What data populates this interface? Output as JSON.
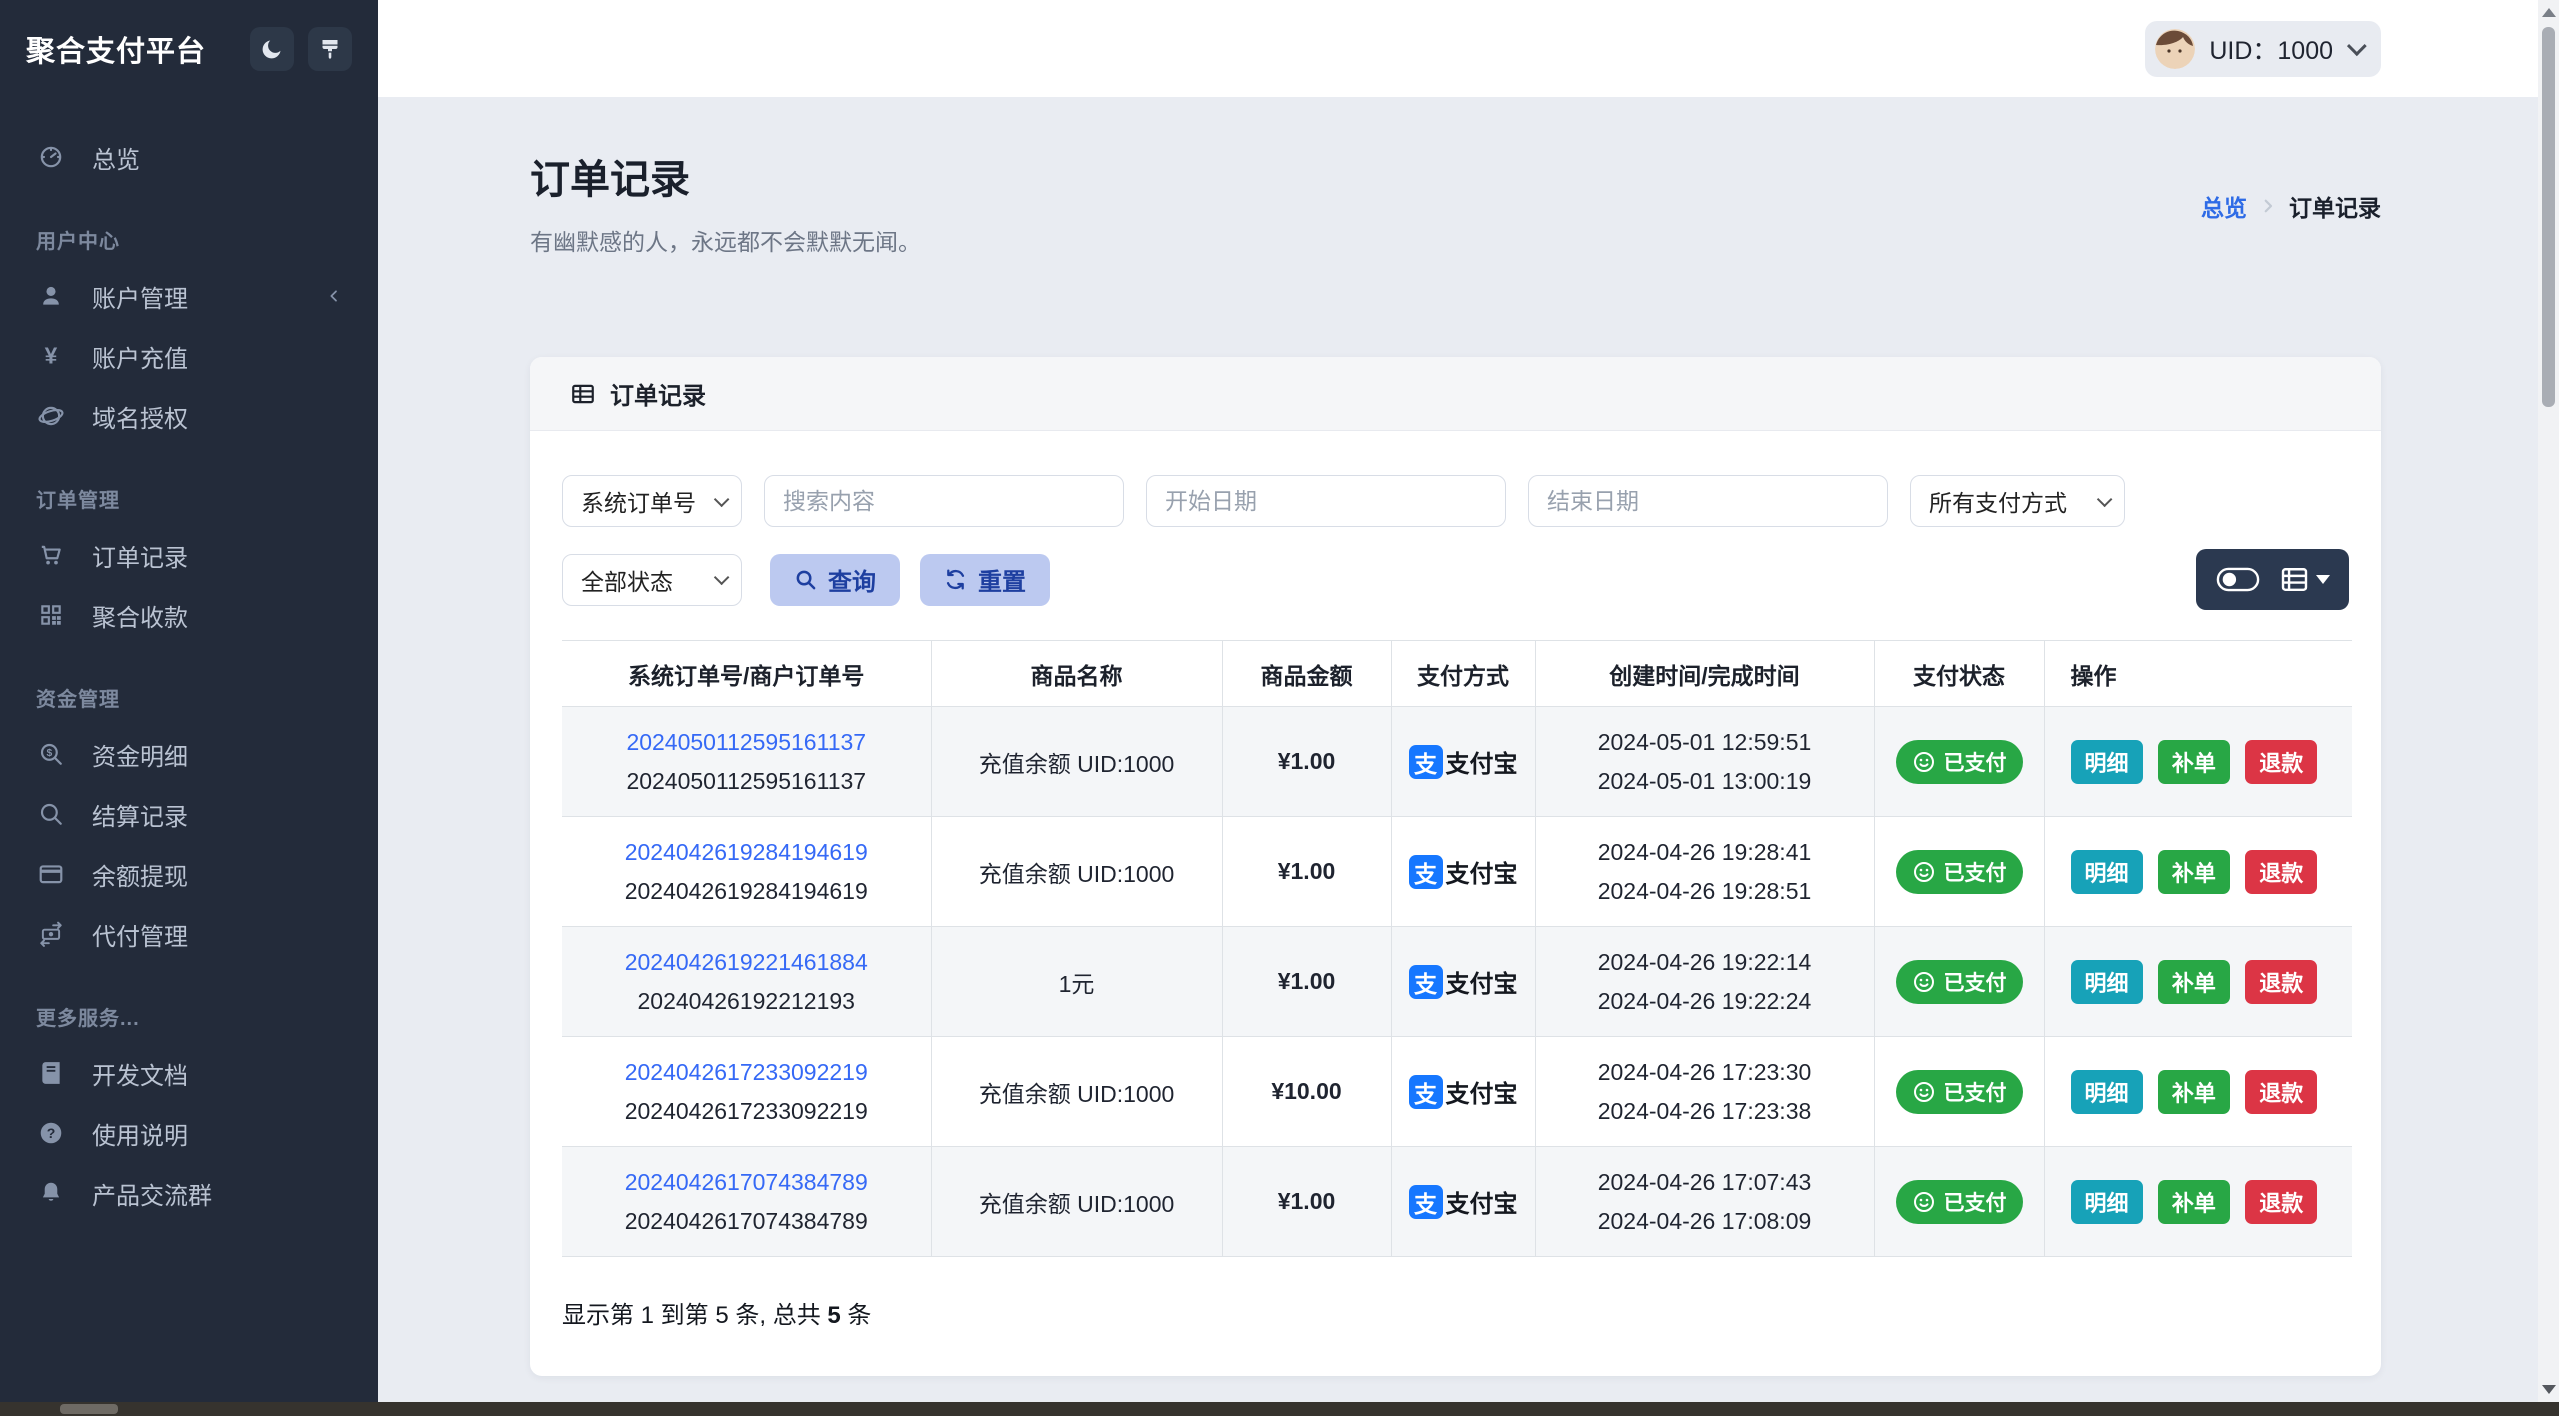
{
  "app": {
    "title": "聚合支付平台"
  },
  "topbar": {
    "uid": "UID：1000"
  },
  "sidebar": {
    "sections": [
      {
        "key": "main",
        "label": "",
        "items": [
          {
            "key": "overview",
            "label": "总览",
            "icon": "dashboard-icon"
          }
        ]
      },
      {
        "key": "user-center",
        "label": "用户中心",
        "items": [
          {
            "key": "account-management",
            "label": "账户管理",
            "icon": "user-icon",
            "collapsible": true
          },
          {
            "key": "account-recharge",
            "label": "账户充值",
            "icon": "yen-icon"
          },
          {
            "key": "domain-authorization",
            "label": "域名授权",
            "icon": "globe-icon"
          }
        ]
      },
      {
        "key": "order-management",
        "label": "订单管理",
        "items": [
          {
            "key": "order-records",
            "label": "订单记录",
            "icon": "cart-icon"
          },
          {
            "key": "aggregate-collection",
            "label": "聚合收款",
            "icon": "qrcode-icon"
          }
        ]
      },
      {
        "key": "fund-management",
        "label": "资金管理",
        "items": [
          {
            "key": "fund-details",
            "label": "资金明细",
            "icon": "search-dollar-icon"
          },
          {
            "key": "settlement-records",
            "label": "结算记录",
            "icon": "search-icon"
          },
          {
            "key": "balance-withdrawal",
            "label": "余额提现",
            "icon": "credit-card-icon"
          },
          {
            "key": "payout-management",
            "label": "代付管理",
            "icon": "money-transfer-icon"
          }
        ]
      },
      {
        "key": "more-services",
        "label": "更多服务...",
        "items": [
          {
            "key": "dev-docs",
            "label": "开发文档",
            "icon": "book-icon"
          },
          {
            "key": "usage-guide",
            "label": "使用说明",
            "icon": "question-icon"
          },
          {
            "key": "product-group",
            "label": "产品交流群",
            "icon": "bell-icon"
          }
        ]
      }
    ]
  },
  "page": {
    "title": "订单记录",
    "subtitle": "有幽默感的人，永远都不会默默无闻。",
    "breadcrumb": {
      "parent": "总览",
      "current": "订单记录"
    }
  },
  "card": {
    "header": "订单记录"
  },
  "filters": {
    "order_type_value": "系统订单号",
    "search_placeholder": "搜索内容",
    "start_date_placeholder": "开始日期",
    "end_date_placeholder": "结束日期",
    "pay_method_value": "所有支付方式",
    "status_value": "全部状态",
    "query_label": "查询",
    "reset_label": "重置"
  },
  "table": {
    "columns": [
      "系统订单号/商户订单号",
      "商品名称",
      "商品金额",
      "支付方式",
      "创建时间/完成时间",
      "支付状态",
      "操作"
    ],
    "action_labels": [
      "明细",
      "补单",
      "退款"
    ],
    "rows": [
      {
        "order_no": "2024050112595161137",
        "merchant_no": "2024050112595161137",
        "product": "充值余额 UID:1000",
        "amount": "¥1.00",
        "method": "支付宝",
        "created": "2024-05-01 12:59:51",
        "completed": "2024-05-01 13:00:19",
        "status": "已支付"
      },
      {
        "order_no": "2024042619284194619",
        "merchant_no": "2024042619284194619",
        "product": "充值余额 UID:1000",
        "amount": "¥1.00",
        "method": "支付宝",
        "created": "2024-04-26 19:28:41",
        "completed": "2024-04-26 19:28:51",
        "status": "已支付"
      },
      {
        "order_no": "2024042619221461884",
        "merchant_no": "20240426192212193",
        "product": "1元",
        "amount": "¥1.00",
        "method": "支付宝",
        "created": "2024-04-26 19:22:14",
        "completed": "2024-04-26 19:22:24",
        "status": "已支付"
      },
      {
        "order_no": "2024042617233092219",
        "merchant_no": "2024042617233092219",
        "product": "充值余额 UID:1000",
        "amount": "¥10.00",
        "method": "支付宝",
        "created": "2024-04-26 17:23:30",
        "completed": "2024-04-26 17:23:38",
        "status": "已支付"
      },
      {
        "order_no": "2024042617074384789",
        "merchant_no": "2024042617074384789",
        "product": "充值余额 UID:1000",
        "amount": "¥1.00",
        "method": "支付宝",
        "created": "2024-04-26 17:07:43",
        "completed": "2024-04-26 17:08:09",
        "status": "已支付"
      }
    ],
    "alipay_glyph": "支"
  },
  "summary": {
    "prefix": "显示第 1 到第 5 条, 总共 ",
    "total": "5",
    "suffix": " 条"
  },
  "colors": {
    "sidebar_bg": "#232b3a",
    "accent_blue": "#2e6be6",
    "link_blue": "#3569f6",
    "alipay_blue": "#1677ff",
    "paid_green": "#28a745",
    "detail_teal": "#17a2b8",
    "refund_red": "#dc3545",
    "soft_button_bg": "#bcc9f0",
    "soft_button_text": "#1e3fa0"
  }
}
